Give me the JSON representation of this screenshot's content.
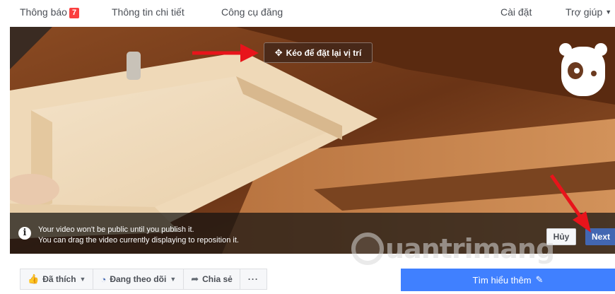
{
  "nav": {
    "notifications_label": "Thông báo",
    "notifications_count": "7",
    "details_label": "Thông tin chi tiết",
    "publishing_tools_label": "Công cụ đăng",
    "settings_label": "Cài đặt",
    "help_label": "Trợ giúp"
  },
  "cover": {
    "drag_label": "Kéo để đặt lại vị trí",
    "info_line1": "Your video won't be public until you publish it.",
    "info_line2": "You can drag the video currently displaying to reposition it.",
    "cancel_label": "Hủy",
    "next_label": "Next"
  },
  "actions": {
    "liked_label": "Đã thích",
    "following_label": "Đang theo dõi",
    "share_label": "Chia sẻ",
    "more_label": "···"
  },
  "cta": {
    "learn_more_label": "Tìm hiểu thêm"
  },
  "watermark": {
    "text": "uantrimang"
  },
  "colors": {
    "accent_blue": "#4267b2",
    "cta_blue": "#4080ff",
    "badge_red": "#fa3e3e",
    "arrow_red": "#e8141b"
  }
}
